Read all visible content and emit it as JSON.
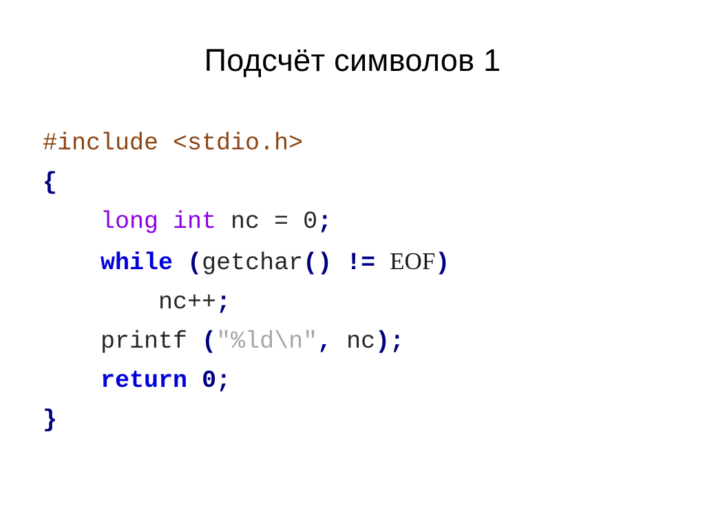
{
  "slide": {
    "title": "Подсчёт символов 1",
    "background_color": "#ffffff",
    "title_color": "#000000"
  },
  "palette": {
    "preprocessor": "#8B4513",
    "type_keyword": "#8B00E6",
    "control_keyword": "#0000DD",
    "punctuation": "#000080",
    "plain_text": "#262626",
    "string_literal": "#A6A6A6",
    "macro_constant": "#1a1a1a"
  },
  "code": {
    "language": "C",
    "lines": [
      {
        "id": "line-include",
        "indent": "",
        "tokens": [
          {
            "text": "#include <stdio.h>",
            "kind": "preproc"
          }
        ]
      },
      {
        "id": "line-open-brace",
        "indent": "",
        "tokens": [
          {
            "text": "{",
            "kind": "punct"
          }
        ]
      },
      {
        "id": "line-declare-nc",
        "indent": "    ",
        "tokens": [
          {
            "text": "long int",
            "kind": "type"
          },
          {
            "text": " nc = 0",
            "kind": "plain"
          },
          {
            "text": ";",
            "kind": "punct"
          }
        ]
      },
      {
        "id": "line-while",
        "indent": "    ",
        "tokens": [
          {
            "text": "while",
            "kind": "keyword"
          },
          {
            "text": " ",
            "kind": "plain"
          },
          {
            "text": "(",
            "kind": "punct"
          },
          {
            "text": "getchar",
            "kind": "plain"
          },
          {
            "text": "()",
            "kind": "punct"
          },
          {
            "text": " ",
            "kind": "plain"
          },
          {
            "text": "!=",
            "kind": "punct"
          },
          {
            "text": " ",
            "kind": "plain"
          },
          {
            "text": "EOF",
            "kind": "macro"
          },
          {
            "text": ")",
            "kind": "punct"
          }
        ]
      },
      {
        "id": "line-increment",
        "indent": "        ",
        "tokens": [
          {
            "text": "nc++",
            "kind": "plain"
          },
          {
            "text": ";",
            "kind": "punct"
          }
        ]
      },
      {
        "id": "line-printf",
        "indent": "    ",
        "tokens": [
          {
            "text": "printf ",
            "kind": "plain"
          },
          {
            "text": "(",
            "kind": "punct"
          },
          {
            "text": "\"%ld\\n\"",
            "kind": "string"
          },
          {
            "text": ",",
            "kind": "punct"
          },
          {
            "text": " nc",
            "kind": "plain"
          },
          {
            "text": ")",
            "kind": "punct"
          },
          {
            "text": ";",
            "kind": "punct"
          }
        ]
      },
      {
        "id": "line-return",
        "indent": "    ",
        "tokens": [
          {
            "text": "return",
            "kind": "keyword"
          },
          {
            "text": " ",
            "kind": "plain"
          },
          {
            "text": "0",
            "kind": "numblue"
          },
          {
            "text": ";",
            "kind": "punct"
          }
        ]
      },
      {
        "id": "line-close-brace",
        "indent": "",
        "tokens": [
          {
            "text": "}",
            "kind": "punct"
          }
        ]
      }
    ]
  }
}
